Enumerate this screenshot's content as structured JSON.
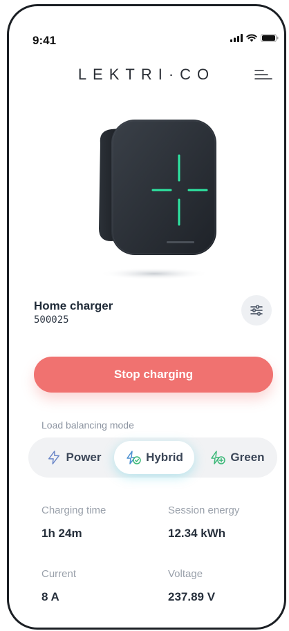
{
  "status_bar": {
    "time": "9:41"
  },
  "header": {
    "brand": "LEKTRI·CO"
  },
  "charger": {
    "name": "Home charger",
    "serial": "500025"
  },
  "actions": {
    "stop_label": "Stop charging"
  },
  "load_balancing": {
    "label": "Load balancing mode",
    "modes": [
      {
        "label": "Power",
        "icon": "lightning-outline-icon",
        "selected": false
      },
      {
        "label": "Hybrid",
        "icon": "hybrid-leaf-icon",
        "selected": true
      },
      {
        "label": "Green",
        "icon": "leaf-icon",
        "selected": false
      }
    ]
  },
  "stats": {
    "charging_time": {
      "label": "Charging time",
      "value": "1h 24m"
    },
    "session_energy": {
      "label": "Session energy",
      "value": "12.34 kWh"
    },
    "current": {
      "label": "Current",
      "value": "8 A"
    },
    "voltage": {
      "label": "Voltage",
      "value": "237.89 V"
    }
  },
  "colors": {
    "accent_red": "#f07270",
    "led_green": "#2ee6a2",
    "hybrid_glow": "#40c8dc",
    "green_mode": "#3cb878"
  }
}
